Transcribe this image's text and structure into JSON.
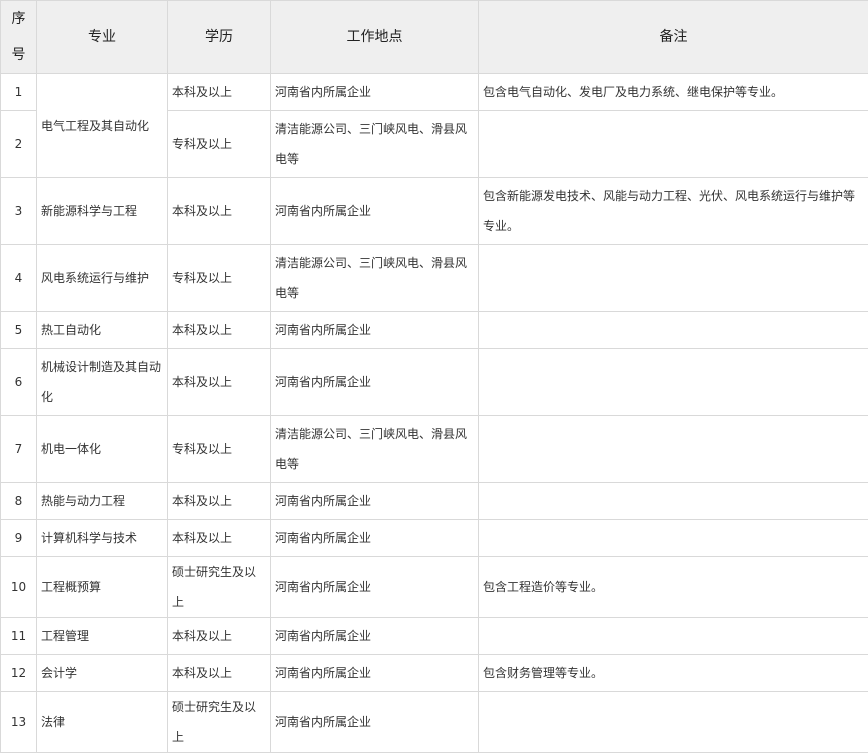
{
  "headers": [
    "序号",
    "专业",
    "学历",
    "工作地点",
    "备注"
  ],
  "rows": [
    {
      "no": "1",
      "major": "电气工程及其自动化",
      "edu": "本科及以上",
      "loc": "河南省内所属企业",
      "note": "包含电气自动化、发电厂及电力系统、继电保护等专业。"
    },
    {
      "no": "2",
      "major": "",
      "edu": "专科及以上",
      "loc": "清洁能源公司、三门峡风电、滑县风电等",
      "note": ""
    },
    {
      "no": "3",
      "major": "新能源科学与工程",
      "edu": "本科及以上",
      "loc": "河南省内所属企业",
      "note": "包含新能源发电技术、风能与动力工程、光伏、风电系统运行与维护等专业。"
    },
    {
      "no": "4",
      "major": "风电系统运行与维护",
      "edu": "专科及以上",
      "loc": "清洁能源公司、三门峡风电、滑县风电等",
      "note": ""
    },
    {
      "no": "5",
      "major": "热工自动化",
      "edu": "本科及以上",
      "loc": "河南省内所属企业",
      "note": ""
    },
    {
      "no": "6",
      "major": "机械设计制造及其自动化",
      "edu": "本科及以上",
      "loc": "河南省内所属企业",
      "note": ""
    },
    {
      "no": "7",
      "major": "机电一体化",
      "edu": "专科及以上",
      "loc": "清洁能源公司、三门峡风电、滑县风电等",
      "note": ""
    },
    {
      "no": "8",
      "major": "热能与动力工程",
      "edu": "本科及以上",
      "loc": "河南省内所属企业",
      "note": ""
    },
    {
      "no": "9",
      "major": "计算机科学与技术",
      "edu": "本科及以上",
      "loc": "河南省内所属企业",
      "note": ""
    },
    {
      "no": "10",
      "major": "工程概预算",
      "edu": "硕士研究生及以上",
      "loc": "河南省内所属企业",
      "note": "包含工程造价等专业。"
    },
    {
      "no": "11",
      "major": "工程管理",
      "edu": "本科及以上",
      "loc": "河南省内所属企业",
      "note": ""
    },
    {
      "no": "12",
      "major": "会计学",
      "edu": "本科及以上",
      "loc": "河南省内所属企业",
      "note": "包含财务管理等专业。"
    },
    {
      "no": "13",
      "major": "法律",
      "edu": "硕士研究生及以上",
      "loc": "河南省内所属企业",
      "note": ""
    }
  ]
}
